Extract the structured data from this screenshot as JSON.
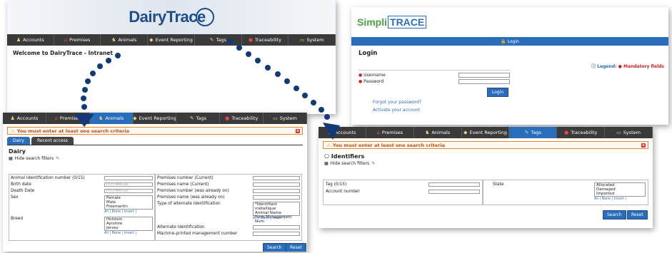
{
  "dairytrace": {
    "logo": "DairyTrace",
    "nav": [
      "Accounts",
      "Premises",
      "Animals",
      "Event Reporting",
      "Tags",
      "Traceability",
      "System"
    ],
    "welcome": "Welcome to DairyTrace - Intranet"
  },
  "simplitrace": {
    "logo_simpli": "Simpli",
    "logo_trace": "TRACE",
    "bar_label": "Login",
    "title": "Login",
    "legend_label": "Legend:",
    "legend_mandatory": "Mandatory fields",
    "username_label": "Username",
    "password_label": "Password",
    "login_button": "Login",
    "forgot_link": "Forgot your password?",
    "activate_link": "Activate your account"
  },
  "dairy_search": {
    "alert": "You must enter at least one search criteria",
    "subtabs": [
      "Dairy",
      "Recent access"
    ],
    "section_title": "Dairy",
    "hide_filters": "Hide search filters",
    "left_fields": [
      "Animal identification number (0/15)",
      "Birth date",
      "Death Date",
      "Sex",
      "Breed"
    ],
    "date_placeholder": "YYYY-MM-DD",
    "sex_options": [
      "Female",
      "Male",
      "Freemartin"
    ],
    "breed_options": [
      "Holstein",
      "Ayrshire",
      "Jersey"
    ],
    "list_footer": "All | None | Invert |",
    "right_fields": [
      "Premises number (Current)",
      "Premises name (Current)",
      "Premises number (was already on)",
      "Premises name (was already on)",
      "Type of alternate identification",
      "Alternate identification",
      "Machine-printed management number"
    ],
    "alt_id_options": [
      "*Identifiant métallique",
      "Animal Name",
      "Farm Management Num"
    ],
    "search_button": "Search",
    "reset_button": "Reset"
  },
  "identifiers": {
    "alert": "You must enter at least one search criteria",
    "section_title": "Identifiers",
    "hide_filters": "Hide search filters",
    "tag_label": "Tag (0/15)",
    "account_label": "Account number",
    "state_label": "State",
    "state_options": [
      "Allocated",
      "Damaged",
      "Imported"
    ],
    "list_footer": "All | None | Invert |",
    "search_button": "Search",
    "reset_button": "Reset"
  }
}
